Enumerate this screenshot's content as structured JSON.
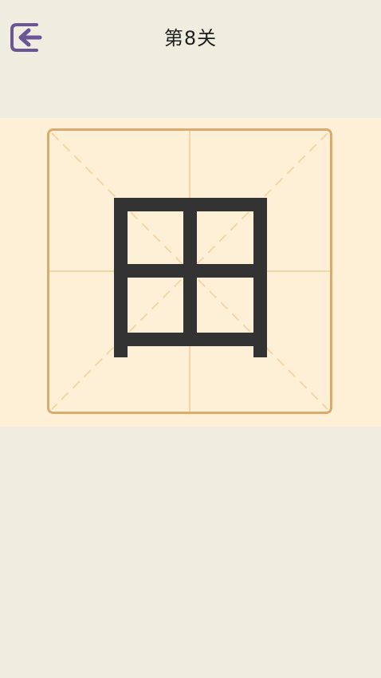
{
  "header": {
    "title": "第8关",
    "back_icon": "exit-arrow-icon"
  },
  "puzzle": {
    "character": "田"
  },
  "colors": {
    "background": "#f0ede0",
    "board_band": "#fdf0d6",
    "grid_border": "#dcaa6c",
    "grid_guides": "#f2d6a8",
    "stroke": "#333333",
    "back_icon": "#6a5596"
  }
}
